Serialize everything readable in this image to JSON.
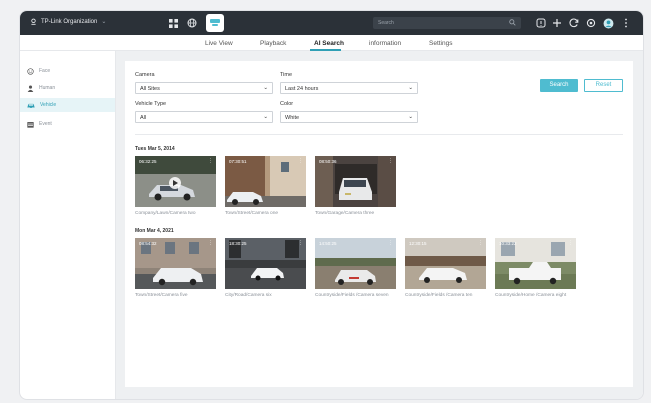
{
  "header": {
    "org_name": "TP-Link Organization",
    "search_placeholder": "Search"
  },
  "tabs": [
    "Live View",
    "Playback",
    "AI Search",
    "information",
    "Settings"
  ],
  "active_tab": "AI Search",
  "sidebar": {
    "items": [
      {
        "label": "Face",
        "icon": "face-icon"
      },
      {
        "label": "Human",
        "icon": "human-icon"
      },
      {
        "label": "Vehicle",
        "icon": "vehicle-icon",
        "active": true
      },
      {
        "label": "Event",
        "icon": "event-icon"
      }
    ]
  },
  "filters": {
    "camera_label": "Camera",
    "camera_value": "All Sites",
    "time_label": "Time",
    "time_value": "Last 24 hours",
    "vehicle_type_label": "Vehicle Type",
    "vehicle_type_value": "All",
    "color_label": "Color",
    "color_value": "White",
    "search_button": "Search",
    "reset_button": "Reset"
  },
  "groups": [
    {
      "date": "Tues Mar 5, 2014",
      "items": [
        {
          "caption": "Company/Lawn/Camera two",
          "timestamp": "06:32:25"
        },
        {
          "caption": "Town/Street/Camera one",
          "timestamp": "07:30:51"
        },
        {
          "caption": "Town/Garage/Camera three",
          "timestamp": "08:50:36"
        }
      ]
    },
    {
      "date": "Mon Mar 4, 2021",
      "items": [
        {
          "caption": "Town/Street/Camera five",
          "timestamp": "08:54:32"
        },
        {
          "caption": "City/Road/Camera six",
          "timestamp": "18:30:25"
        },
        {
          "caption": "Countryside/Fields /Camera seven",
          "timestamp": "14:50:25"
        },
        {
          "caption": "Countryside/Fields /Camera ten",
          "timestamp": "12:30:15"
        },
        {
          "caption": "Countryside/Home /Camera eight",
          "timestamp": "10:33:22"
        }
      ]
    }
  ],
  "colors": {
    "accent": "#4fbcd0",
    "topbar": "#2b3138"
  }
}
